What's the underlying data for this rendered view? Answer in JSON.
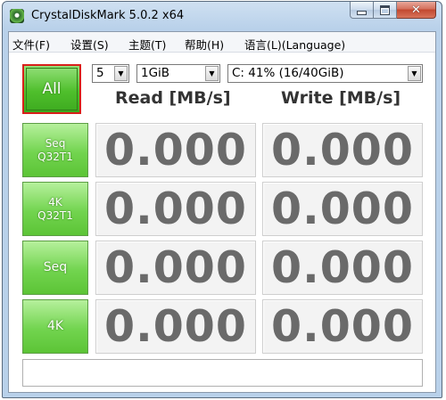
{
  "window": {
    "title": "CrystalDiskMark 5.0.2 x64",
    "close_glyph": "✕"
  },
  "menu": [
    {
      "label": "文件(F)"
    },
    {
      "label": "设置(S)"
    },
    {
      "label": "主题(T)"
    },
    {
      "label": "帮助(H)"
    },
    {
      "label": "语言(L)(Language)"
    }
  ],
  "controls": {
    "all_label": "All",
    "count_value": "5",
    "size_value": "1GiB",
    "drive_value": "C: 41% (16/40GiB)",
    "arrow_glyph": "▼"
  },
  "headers": {
    "read": "Read [MB/s]",
    "write": "Write [MB/s]"
  },
  "tests": [
    {
      "label_line1": "Seq",
      "label_line2": "Q32T1",
      "read": "0.000",
      "write": "0.000"
    },
    {
      "label_line1": "4K",
      "label_line2": "Q32T1",
      "read": "0.000",
      "write": "0.000"
    },
    {
      "label_line1": "Seq",
      "label_line2": "",
      "read": "0.000",
      "write": "0.000"
    },
    {
      "label_line1": "4K",
      "label_line2": "",
      "read": "0.000",
      "write": "0.000"
    }
  ],
  "comment": {
    "value": ""
  },
  "colors": {
    "accent_green": "#5cc436",
    "all_border_red": "#d8201b",
    "result_text": "#6a6a6a"
  }
}
